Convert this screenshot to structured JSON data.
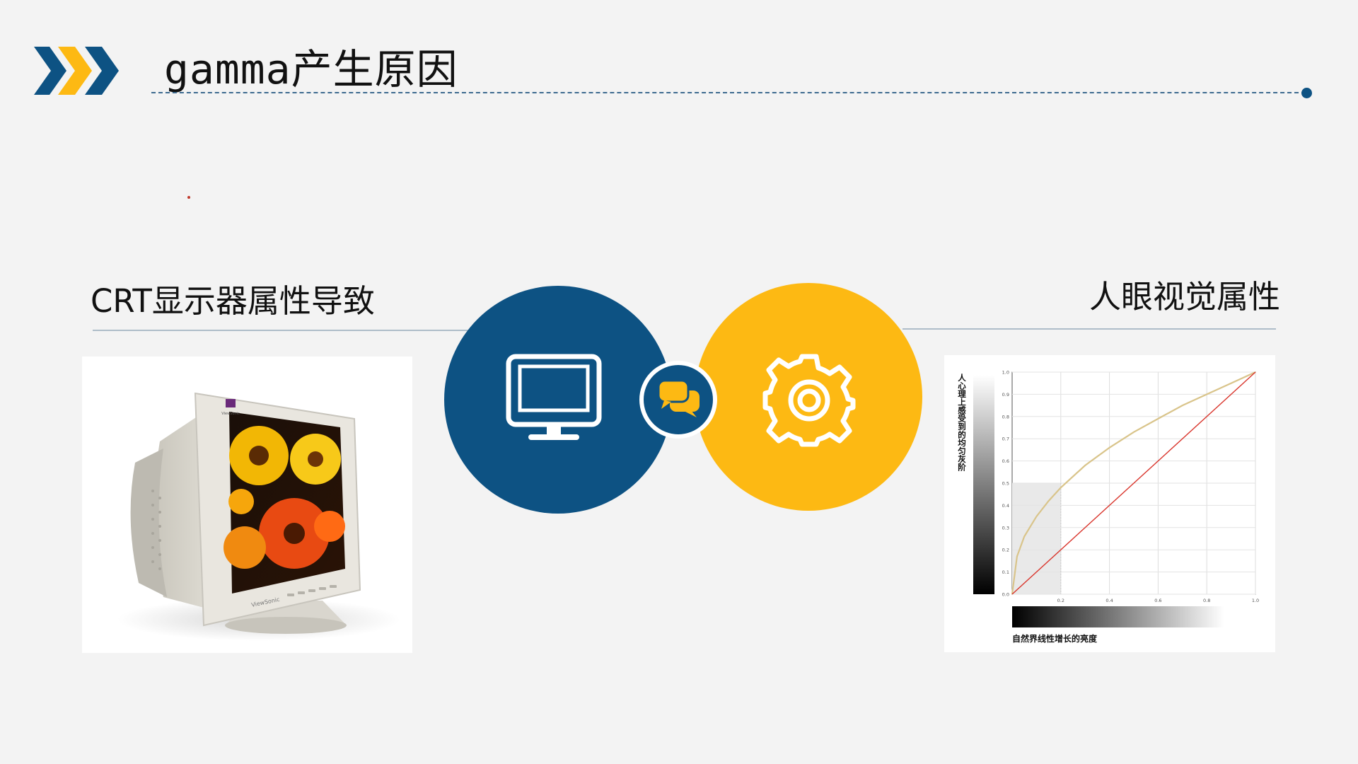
{
  "slide": {
    "title": "gamma产生原因",
    "left_heading": "CRT显示器属性导致",
    "right_heading": "人眼视觉属性"
  },
  "crt_image": {
    "brand_badge": "ViewSonic",
    "front_label": "ViewSonic"
  },
  "icons": [
    "chevron-icon",
    "monitor-icon",
    "chat-bubbles-icon",
    "gear-icon"
  ],
  "colors": {
    "navy": "#0d5283",
    "yellow": "#fdb913",
    "background": "#f3f3f3"
  },
  "chart_data": {
    "type": "line",
    "ylabel": "人心理上感受到的均匀灰阶",
    "xlabel": "自然界线性增长的亮度",
    "xlim": [
      0,
      1.0
    ],
    "ylim": [
      0,
      1.0
    ],
    "x_ticks": [
      "0.2",
      "0.4",
      "0.6",
      "0.8",
      "1.0"
    ],
    "y_ticks": [
      "0.0",
      "0.1",
      "0.2",
      "0.3",
      "0.4",
      "0.5",
      "0.6",
      "0.7",
      "0.8",
      "0.9",
      "1.0"
    ],
    "grid": true,
    "series": [
      {
        "color": "#d9c48a",
        "x": [
          0,
          0.02,
          0.05,
          0.1,
          0.15,
          0.2,
          0.3,
          0.4,
          0.5,
          0.6,
          0.7,
          0.8,
          0.9,
          1.0
        ],
        "y": [
          0,
          0.17,
          0.26,
          0.35,
          0.42,
          0.48,
          0.58,
          0.66,
          0.73,
          0.79,
          0.85,
          0.9,
          0.95,
          1.0
        ]
      },
      {
        "color": "#d9342b",
        "x": [
          0,
          1.0
        ],
        "y": [
          0,
          1.0
        ]
      }
    ],
    "highlight_region": {
      "x": [
        0,
        0.2
      ],
      "y": [
        0,
        0.5
      ]
    }
  }
}
